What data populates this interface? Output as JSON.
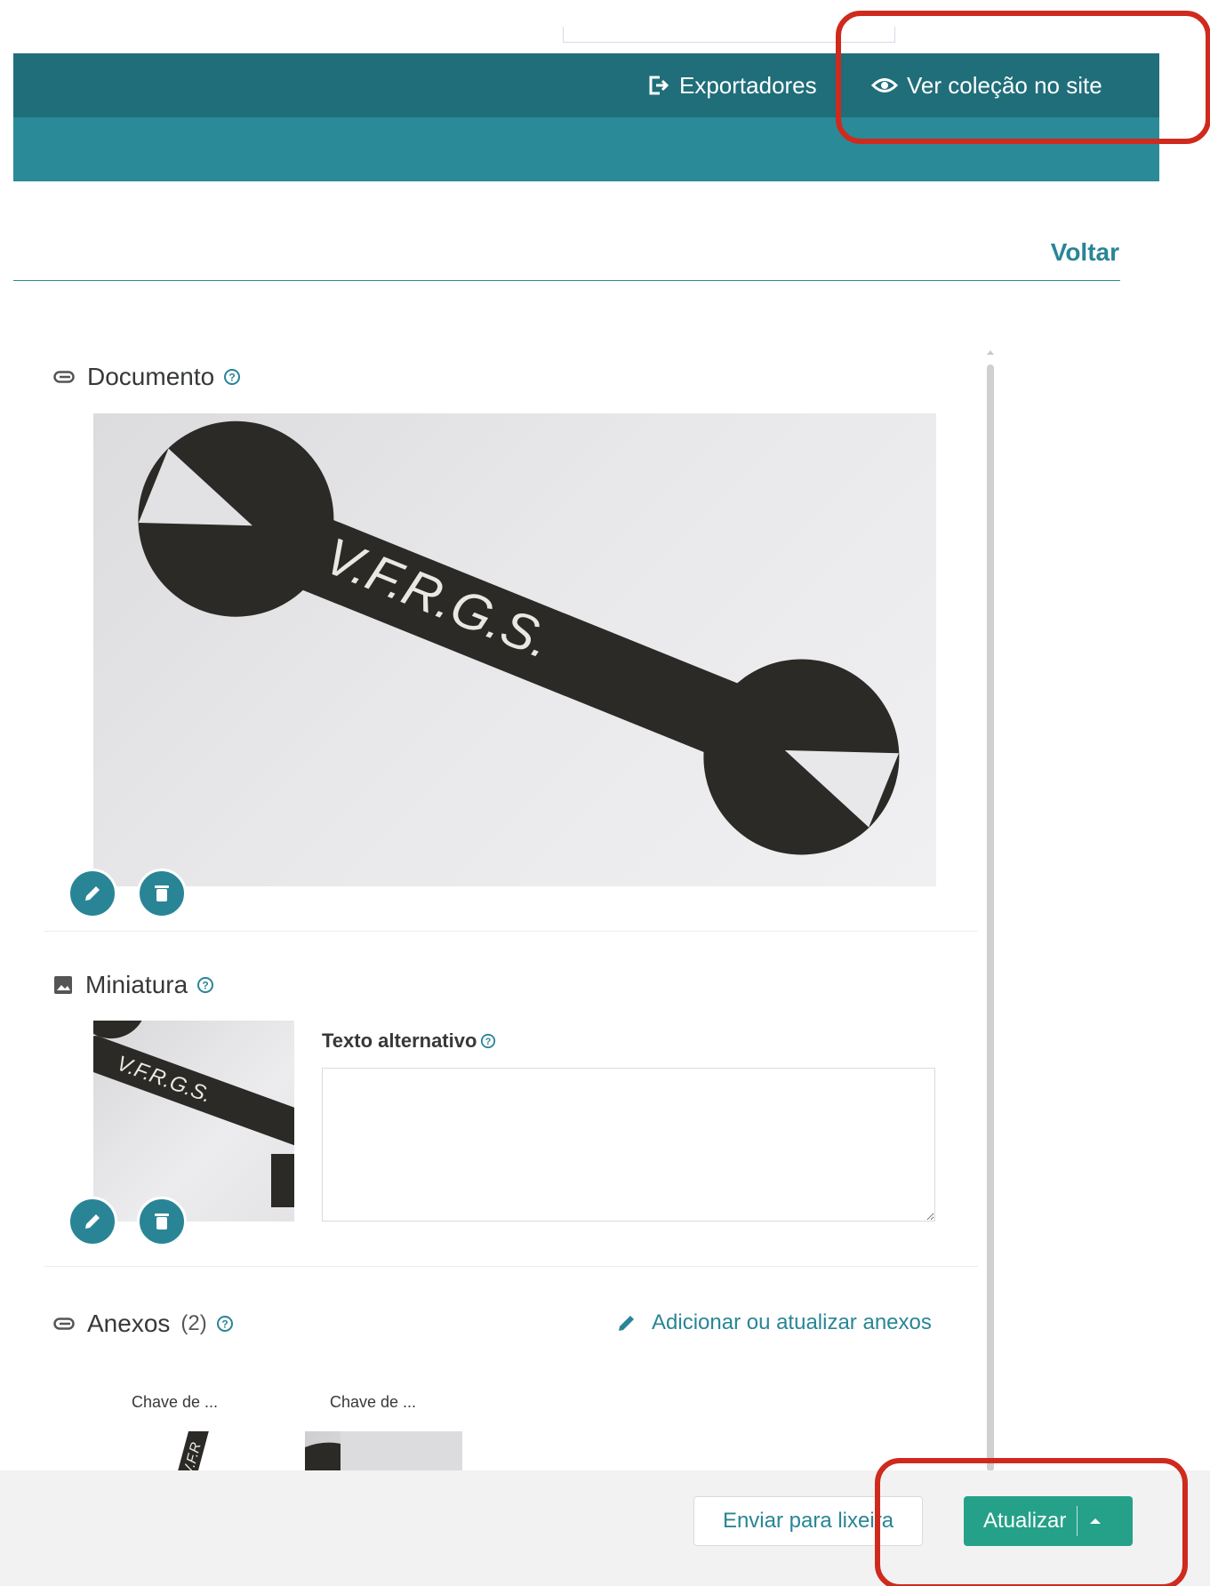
{
  "header": {
    "exportadores_label": "Exportadores",
    "ver_colecao_label": "Ver coleção no site",
    "voltar_label": "Voltar"
  },
  "document": {
    "title": "Documento",
    "image_alt": "V.F.R.G.S."
  },
  "miniatura": {
    "title": "Miniatura",
    "alt_text_label": "Texto alternativo",
    "alt_text_value": ""
  },
  "anexos": {
    "title": "Anexos",
    "count": "(2)",
    "add_link_label": "Adicionar ou atualizar anexos",
    "items": [
      {
        "name": "Chave de ..."
      },
      {
        "name": "Chave de ..."
      }
    ]
  },
  "footer": {
    "lixeira_label": "Enviar para lixeira",
    "atualizar_label": "Atualizar"
  },
  "colors": {
    "header_dark": "#1f6e7a",
    "header_light": "#2a8a98",
    "accent": "#298596",
    "primary_button": "#25a189",
    "annotation": "#cf2a1d"
  }
}
